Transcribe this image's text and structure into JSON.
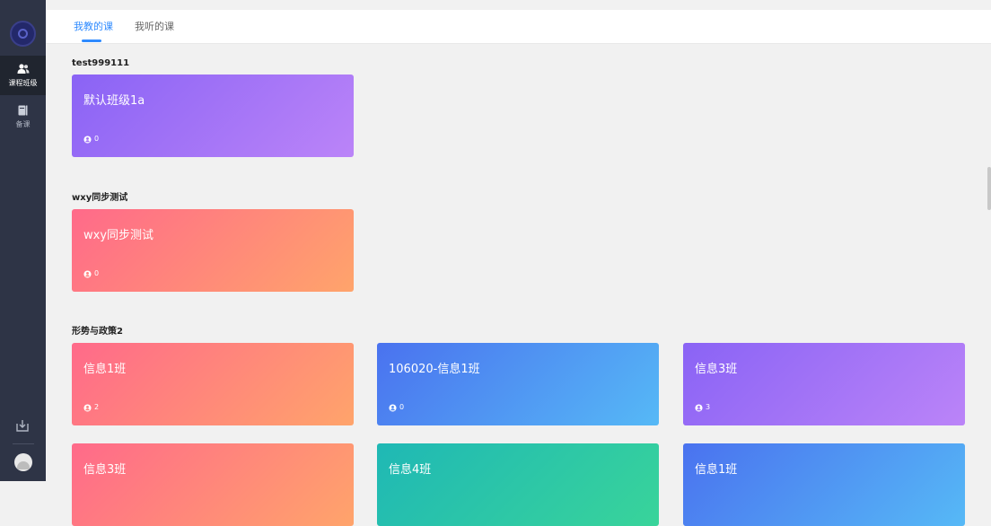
{
  "sidebar": {
    "items": [
      {
        "label": "课程班级",
        "icon": "users-icon"
      },
      {
        "label": "备课",
        "icon": "book-icon"
      }
    ]
  },
  "tabs": [
    {
      "label": "我教的课"
    },
    {
      "label": "我听的课"
    }
  ],
  "sections": [
    {
      "title": "test999111",
      "classes": [
        {
          "name": "默认班级1a",
          "students": "0",
          "color": "#8a63f5"
        }
      ]
    },
    {
      "title": "wxy同步测试",
      "classes": [
        {
          "name": "wxy同步测试",
          "students": "0",
          "color": "#ff6a8a"
        }
      ]
    },
    {
      "title": "形势与政策2",
      "classes": [
        {
          "name": "信息1班",
          "students": "2",
          "color": "#ff6a8a"
        },
        {
          "name": "106020-信息1班",
          "students": "0",
          "color": "#4a72ef"
        },
        {
          "name": "信息3班",
          "students": "3",
          "color": "#8a63f5"
        },
        {
          "name": "信息3班",
          "color": "#ff6a8a"
        },
        {
          "name": "信息4班",
          "color": "#1fb8b5"
        },
        {
          "name": "信息1班",
          "color": "#4a72ef"
        }
      ]
    }
  ]
}
